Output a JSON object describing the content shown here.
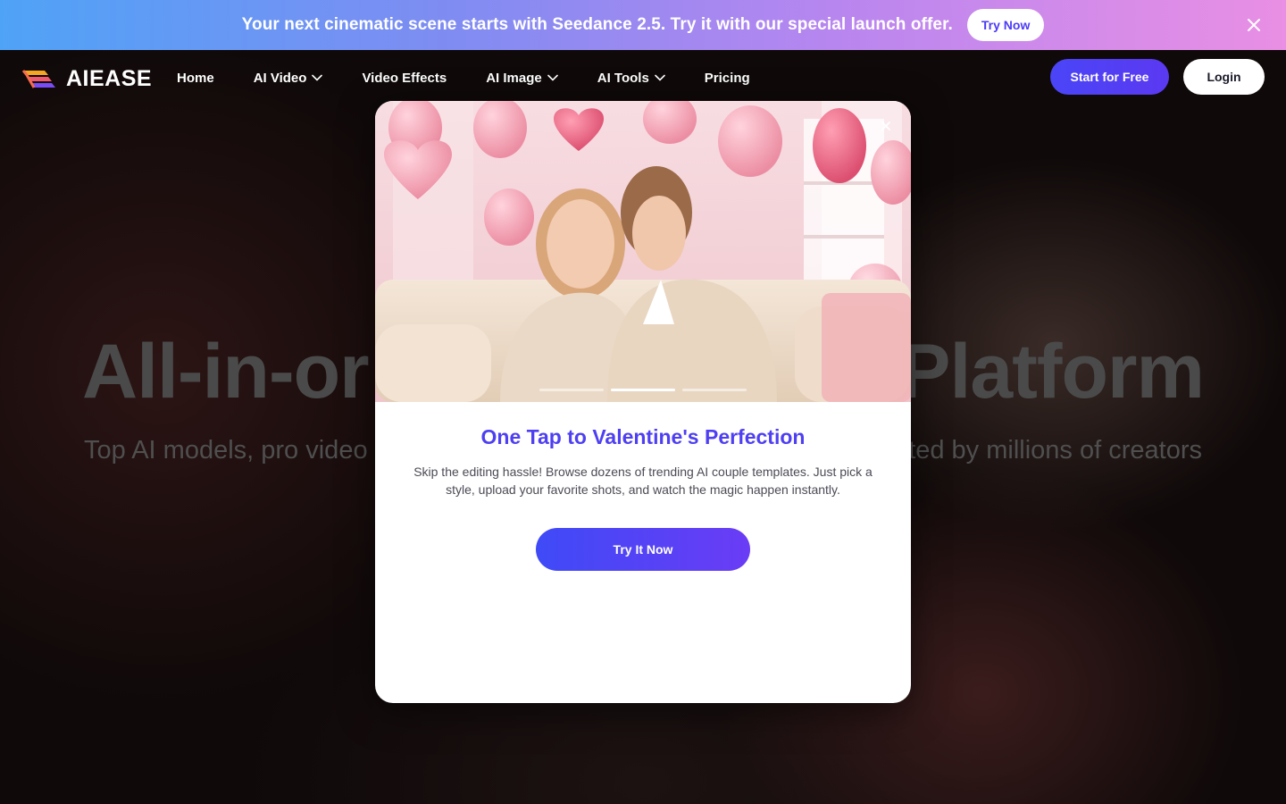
{
  "promo": {
    "text": "Your next cinematic scene starts with Seedance 2.5. Try it with our special launch offer.",
    "button": "Try Now",
    "close_icon": "close-icon"
  },
  "nav": {
    "brand": "AIEASE",
    "items": [
      {
        "label": "Home",
        "has_dropdown": false
      },
      {
        "label": "AI Video",
        "has_dropdown": true
      },
      {
        "label": "Video Effects",
        "has_dropdown": false
      },
      {
        "label": "AI Image",
        "has_dropdown": true
      },
      {
        "label": "AI Tools",
        "has_dropdown": true
      },
      {
        "label": "Pricing",
        "has_dropdown": false
      }
    ],
    "start_button": "Start for Free",
    "login_button": "Login"
  },
  "hero": {
    "title_left": "All-in-or",
    "title_right": "Platform",
    "subtitle_left": "Top AI models, pro video &",
    "subtitle_right": "ted by millions of creators"
  },
  "modal": {
    "title": "One Tap to Valentine's Perfection",
    "description": "Skip the editing hassle! Browse dozens of trending AI couple templates. Just pick a style, upload your favorite shots, and watch the magic happen instantly.",
    "cta": "Try It Now",
    "carousel_active_index": 1,
    "carousel_count": 3
  },
  "colors": {
    "accent": "#4e3ff2",
    "button_gradient_start": "#3f4af7",
    "button_gradient_end": "#6a3cf5",
    "banner_gradient_start": "#4fa3f7",
    "banner_gradient_end": "#e98fe4"
  }
}
